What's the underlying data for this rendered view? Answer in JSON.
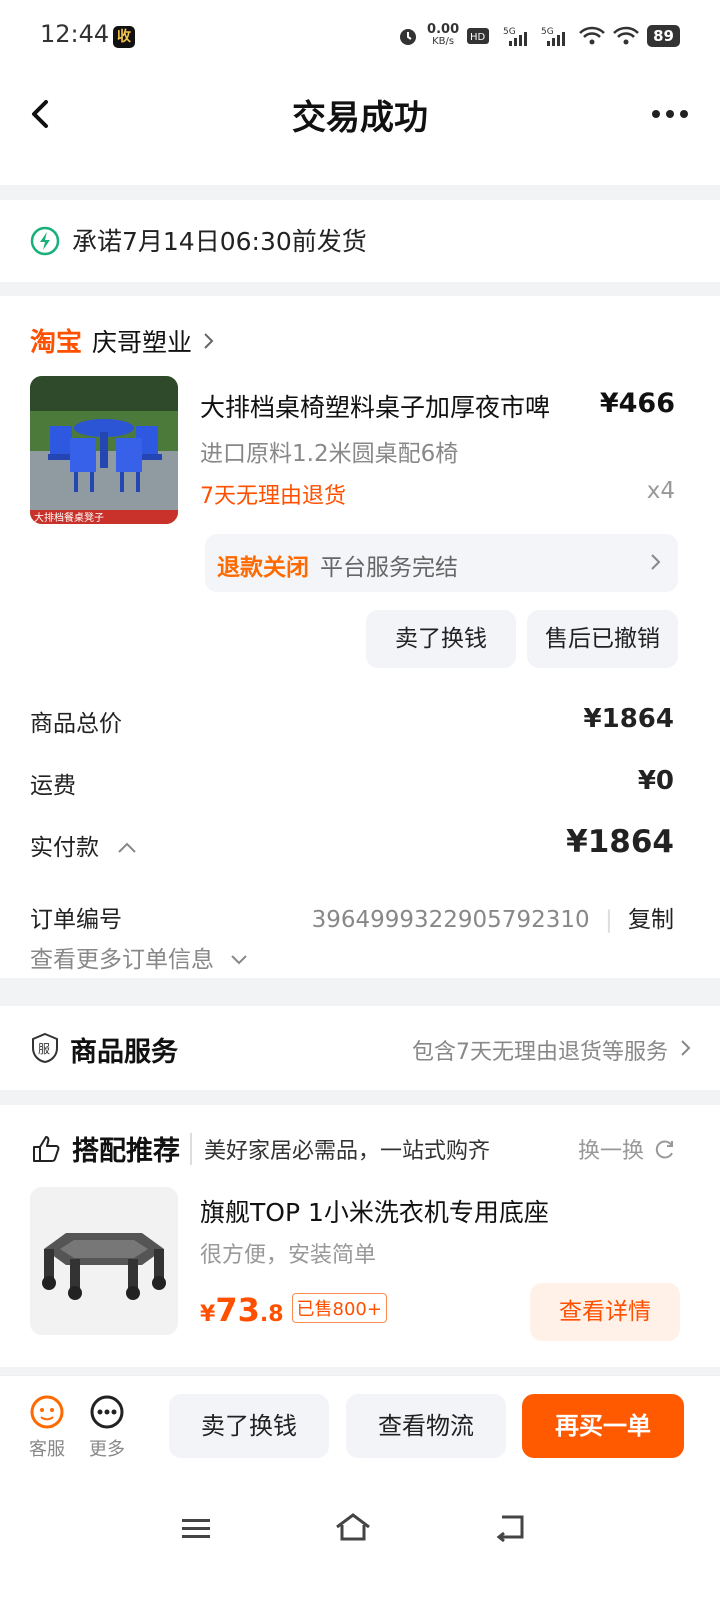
{
  "status_bar": {
    "time": "12:44",
    "app_badge": "收",
    "net_speed": "0.00",
    "net_unit": "KB/s",
    "battery": "89"
  },
  "header": {
    "title": "交易成功"
  },
  "promise": {
    "text": "承诺7月14日06:30前发货"
  },
  "shop": {
    "platform": "淘宝",
    "name": "庆哥塑业"
  },
  "product": {
    "name": "大排档桌椅塑料桌子加厚夜市啤",
    "spec": "进口原料1.2米圆桌配6椅",
    "return_policy": "7天无理由退货",
    "price": "¥466",
    "qty": "x4",
    "thumb_caption": "大排档餐桌凳子"
  },
  "refund": {
    "status": "退款关闭",
    "desc": "平台服务完结"
  },
  "product_actions": {
    "sell": "卖了换钱",
    "after_sale": "售后已撤销"
  },
  "summary": {
    "total_label": "商品总价",
    "total_value": "¥1864",
    "shipping_label": "运费",
    "shipping_value": "¥0",
    "paid_label": "实付款",
    "paid_value": "¥1864",
    "order_label": "订单编号",
    "order_no": "3964999322905792310",
    "copy": "复制",
    "more_info": "查看更多订单信息"
  },
  "service": {
    "icon_text": "服",
    "title": "商品服务",
    "desc": "包含7天无理由退货等服务"
  },
  "recommend": {
    "title": "搭配推荐",
    "subtitle": "美好家居必需品，一站式购齐",
    "swap": "换一换",
    "item": {
      "name": "旗舰TOP 1小米洗衣机专用底座",
      "desc": "很方便，安装简单",
      "price_symbol": "¥",
      "price_int": "73",
      "price_dec": ".8",
      "sold": "已售800+",
      "detail_button": "查看详情"
    }
  },
  "bottom_bar": {
    "service_label": "客服",
    "more_label": "更多",
    "sell_button": "卖了换钱",
    "logistics_button": "查看物流",
    "rebuy_button": "再买一单"
  },
  "colors": {
    "accent": "#ff5000",
    "promise_icon": "#19b07a"
  }
}
